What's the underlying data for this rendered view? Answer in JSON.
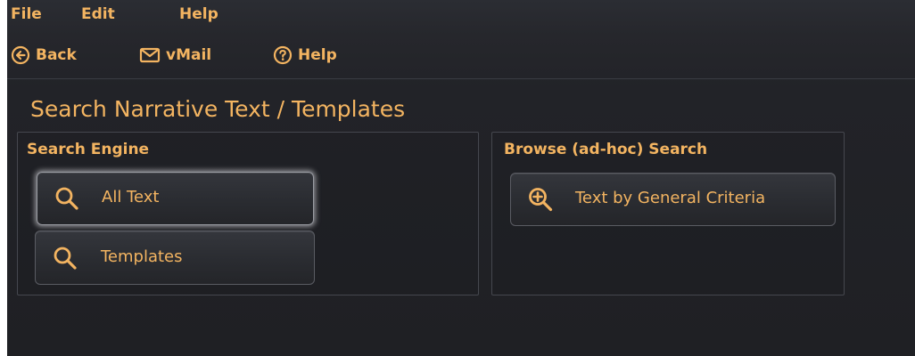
{
  "menubar": {
    "items": [
      {
        "label": "File"
      },
      {
        "label": "Edit"
      },
      {
        "label": "Help"
      }
    ]
  },
  "toolbar": {
    "back_label": "Back",
    "vmail_label": "vMail",
    "help_label": "Help"
  },
  "page": {
    "title": "Search Narrative Text / Templates"
  },
  "search_engine": {
    "title": "Search Engine",
    "buttons": [
      {
        "label": "All Text",
        "icon": "search-icon"
      },
      {
        "label": "Templates",
        "icon": "search-icon"
      }
    ]
  },
  "browse_search": {
    "title": "Browse (ad-hoc) Search",
    "buttons": [
      {
        "label": "Text by General Criteria",
        "icon": "zoom-in-icon"
      }
    ]
  },
  "colors": {
    "accent": "#f3b461",
    "background": "#222328",
    "panel_border": "#45474e"
  }
}
